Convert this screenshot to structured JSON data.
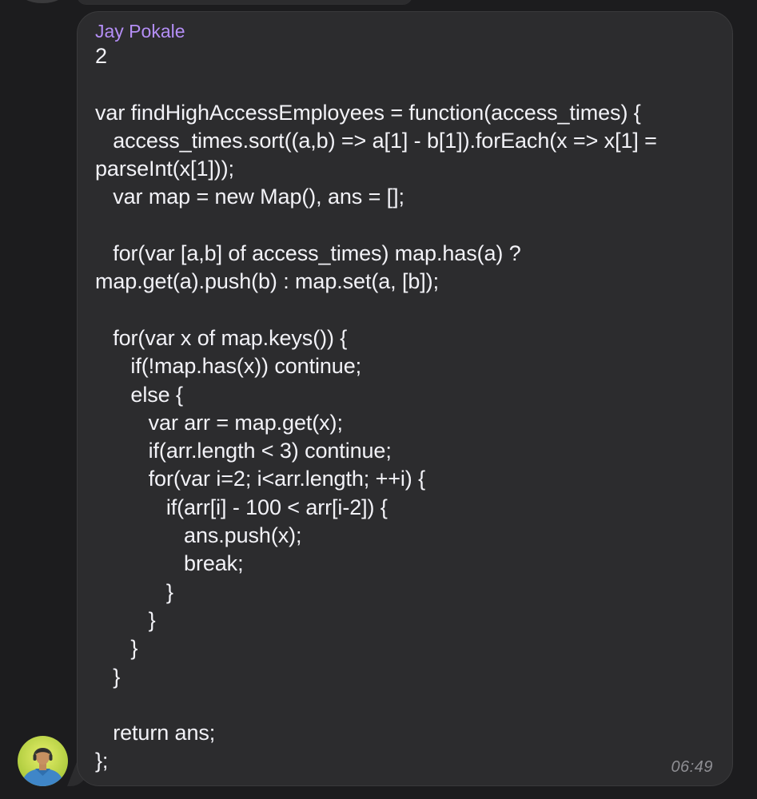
{
  "message": {
    "sender": "Jay Pokale",
    "lines": [
      "2",
      "",
      "var findHighAccessEmployees = function(access_times) {",
      "   access_times.sort((a,b) => a[1] - b[1]).forEach(x => x[1] =",
      "parseInt(x[1]));",
      "   var map = new Map(), ans = [];",
      "",
      "   for(var [a,b] of access_times) map.has(a) ?",
      "map.get(a).push(b) : map.set(a, [b]);",
      "",
      "   for(var x of map.keys()) {",
      "      if(!map.has(x)) continue;",
      "      else {",
      "         var arr = map.get(x);",
      "         if(arr.length < 3) continue;",
      "         for(var i=2; i<arr.length; ++i) {",
      "            if(arr[i] - 100 < arr[i-2]) {",
      "               ans.push(x);",
      "               break;",
      "            }",
      "         }",
      "      }",
      "   }",
      "",
      "   return ans;",
      "};"
    ],
    "time": "06:49"
  },
  "colors": {
    "background": "#1c1c1e",
    "bubble": "#2c2c2e",
    "sender_name": "#b48ef5",
    "text": "#f2f2f7",
    "timestamp": "#8e8e93"
  }
}
